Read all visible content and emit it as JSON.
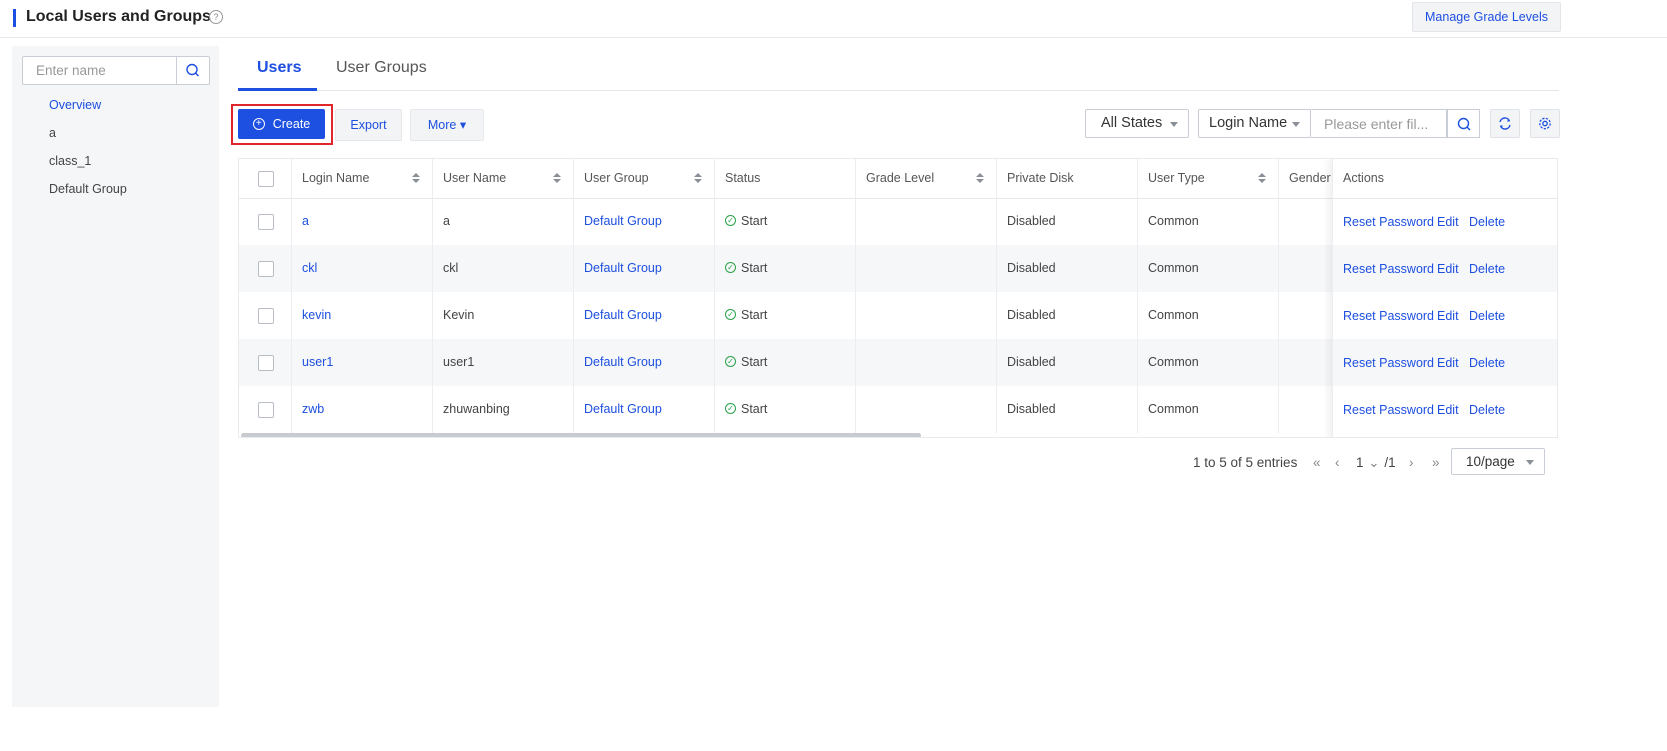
{
  "header": {
    "title": "Local Users and Groups",
    "help": "?",
    "manage_label": "Manage Grade Levels"
  },
  "sidebar": {
    "search_placeholder": "Enter name",
    "items": [
      "Overview",
      "a",
      "class_1",
      "Default Group"
    ],
    "active_index": 0
  },
  "tabs": [
    {
      "label": "Users",
      "active": true
    },
    {
      "label": "User Groups",
      "active": false
    }
  ],
  "toolbar": {
    "create_label": "Create",
    "export_label": "Export",
    "more_label": "More ▾",
    "state_select": "All States",
    "field_select": "Login Name",
    "filter_placeholder": "Please enter fil..."
  },
  "table": {
    "columns": [
      "Login Name",
      "User Name",
      "User Group",
      "Status",
      "Grade Level",
      "Private Disk",
      "User Type",
      "Gender",
      "Actions"
    ],
    "rows": [
      {
        "login": "a",
        "user": "a",
        "group": "Default Group",
        "status": "Start",
        "grade": "",
        "disk": "Disabled",
        "type": "Common",
        "gender": ""
      },
      {
        "login": "ckl",
        "user": "ckl",
        "group": "Default Group",
        "status": "Start",
        "grade": "",
        "disk": "Disabled",
        "type": "Common",
        "gender": ""
      },
      {
        "login": "kevin",
        "user": "Kevin",
        "group": "Default Group",
        "status": "Start",
        "grade": "",
        "disk": "Disabled",
        "type": "Common",
        "gender": ""
      },
      {
        "login": "user1",
        "user": "user1",
        "group": "Default Group",
        "status": "Start",
        "grade": "",
        "disk": "Disabled",
        "type": "Common",
        "gender": ""
      },
      {
        "login": "zwb",
        "user": "zhuwanbing",
        "group": "Default Group",
        "status": "Start",
        "grade": "",
        "disk": "Disabled",
        "type": "Common",
        "gender": ""
      }
    ],
    "actions": [
      "Reset Password",
      "Edit",
      "Delete"
    ]
  },
  "pagination": {
    "summary": "1 to 5 of 5 entries",
    "first": "«",
    "prev": "‹",
    "current": "1",
    "total": "/1",
    "next": "›",
    "last": "»",
    "page_size": "10/page"
  },
  "colors": {
    "accent": "#1d4fe0",
    "highlight": "#e0262b",
    "status_ok": "#2aa14a"
  }
}
